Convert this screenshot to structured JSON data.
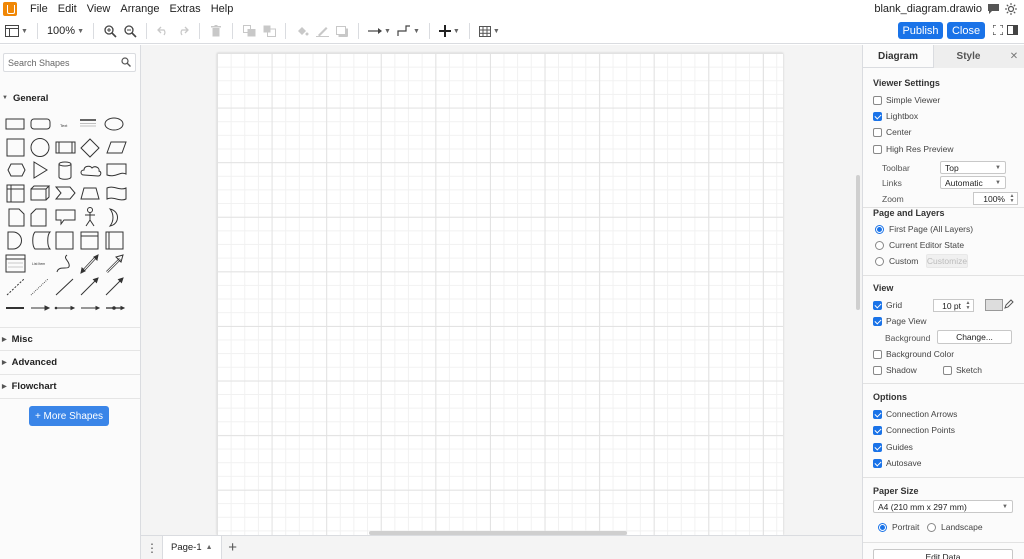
{
  "menubar": {
    "items": [
      "File",
      "Edit",
      "View",
      "Arrange",
      "Extras",
      "Help"
    ],
    "document_title": "blank_diagram.drawio"
  },
  "toolbar": {
    "zoom": "100%",
    "publish_label": "Publish",
    "close_label": "Close"
  },
  "sidebar": {
    "search_placeholder": "Search Shapes",
    "sections": [
      "General",
      "Misc",
      "Advanced",
      "Flowchart"
    ],
    "shape_text_label": "Text",
    "shape_list_label": "List Item",
    "more_shapes_label": "+ More Shapes"
  },
  "footer": {
    "page_tab": "Page-1"
  },
  "format_panel": {
    "tabs": [
      "Diagram",
      "Style"
    ],
    "viewer_settings": {
      "heading": "Viewer Settings",
      "simple_viewer": "Simple Viewer",
      "lightbox": "Lightbox",
      "center": "Center",
      "high_res_preview": "High Res Preview",
      "toolbar_label": "Toolbar",
      "toolbar_value": "Top",
      "links_label": "Links",
      "links_value": "Automatic",
      "zoom_label": "Zoom",
      "zoom_value": "100%"
    },
    "page_and_layers": {
      "heading": "Page and Layers",
      "first_page": "First Page (All Layers)",
      "current_editor_state": "Current Editor State",
      "custom": "Custom",
      "customize": "Customize"
    },
    "view": {
      "heading": "View",
      "grid": "Grid",
      "grid_size": "10 pt",
      "page_view": "Page View",
      "background": "Background",
      "change": "Change...",
      "background_color": "Background Color",
      "shadow": "Shadow",
      "sketch": "Sketch"
    },
    "options": {
      "heading": "Options",
      "connection_arrows": "Connection Arrows",
      "connection_points": "Connection Points",
      "guides": "Guides",
      "autosave": "Autosave"
    },
    "paper_size": {
      "heading": "Paper Size",
      "value": "A4 (210 mm x 297 mm)",
      "portrait": "Portrait",
      "landscape": "Landscape"
    },
    "edit_data_label": "Edit Data"
  },
  "colors": {
    "accent": "#1a73e8",
    "more_shapes": "#3a85e8",
    "logo": "#f08705"
  }
}
